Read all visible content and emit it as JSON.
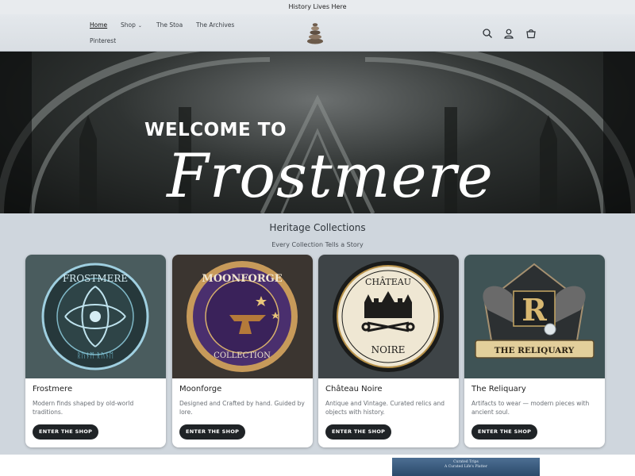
{
  "announcement": "History Lives Here",
  "nav": {
    "items": [
      {
        "label": "Home",
        "active": true
      },
      {
        "label": "Shop",
        "has_dropdown": true
      },
      {
        "label": "The Stoa"
      },
      {
        "label": "The Archives"
      },
      {
        "label": "Pinterest"
      }
    ]
  },
  "header_icons": [
    "search-icon",
    "account-icon",
    "cart-icon"
  ],
  "hero": {
    "welcome": "WELCOME TO",
    "name": "Frostmere"
  },
  "collections": {
    "title": "Heritage Collections",
    "subtitle": "Every Collection Tells a Story",
    "cards": [
      {
        "title": "Frostmere",
        "description": "Modern finds shaped by old-world traditions.",
        "button": "ENTER THE SHOP",
        "emblem_text": "FROSTMERE",
        "emblem_runes": "ᚱᚢᚾᛖ ᚱᚢᚾᛖ"
      },
      {
        "title": "Moonforge",
        "description": "Designed and Crafted by hand. Guided by lore.",
        "button": "ENTER THE SHOP",
        "emblem_text": "MOONFORGE",
        "emblem_sub": "COLLECTION"
      },
      {
        "title": "Château Noire",
        "description": "Antique and Vintage. Curated relics and objects with history.",
        "button": "ENTER THE SHOP",
        "emblem_text": "CHÂTEAU",
        "emblem_sub": "NOIRE"
      },
      {
        "title": "The Reliquary",
        "description": "Artifacts to wear — modern pieces with ancient soul.",
        "button": "ENTER THE SHOP",
        "emblem_text": "THE RELIQUARY",
        "emblem_letter": "R"
      }
    ]
  },
  "mini_banner": {
    "line1": "Curated Trips",
    "line2": "A Curated Life's Platter"
  },
  "colors": {
    "accent_dark": "#1f2326",
    "page_bg": "#cfd6dd",
    "card_bg": "#ffffff"
  }
}
